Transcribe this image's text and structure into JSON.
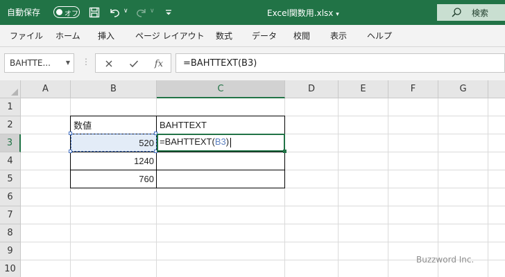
{
  "titlebar": {
    "autosave_label": "自動保存",
    "autosave_toggle": "オフ",
    "filename": "Excel関数用.xlsx",
    "filename_caret": "▾",
    "search_label": "検索",
    "accent_color": "#217346"
  },
  "ribbon": {
    "tabs": [
      "ファイル",
      "ホーム",
      "挿入",
      "ページ レイアウト",
      "数式",
      "データ",
      "校閲",
      "表示",
      "ヘルプ"
    ]
  },
  "formula_bar": {
    "name_box": "BAHTTE...",
    "formula": "=BAHTTEXT(B3)"
  },
  "sheet": {
    "columns": [
      "A",
      "B",
      "C",
      "D",
      "E",
      "F",
      "G"
    ],
    "rows": [
      "1",
      "2",
      "3",
      "4",
      "5",
      "6",
      "7",
      "8",
      "9",
      "10"
    ],
    "header_b2": "数値",
    "header_c2": "BAHTTEXT",
    "values": [
      "520",
      "1240",
      "760"
    ],
    "edit_prefix": "=BAHTTEXT(",
    "edit_ref": "B3",
    "edit_suffix": ")"
  },
  "watermark": "Buzzword Inc."
}
